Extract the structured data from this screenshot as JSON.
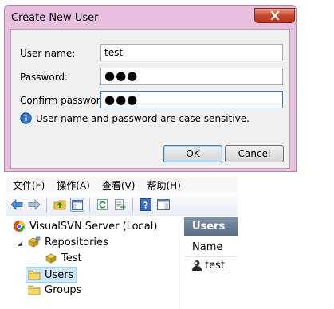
{
  "dialog": {
    "title": "Create New User",
    "username_label": "User name:",
    "username_value": "test",
    "password_label": "Password:",
    "password_value": "●●●",
    "confirm_label": "Confirm password:",
    "confirm_value": "●●●",
    "info_text": "User name and password are case sensitive.",
    "ok_label": "OK",
    "cancel_label": "Cancel"
  },
  "menubar": {
    "items": [
      "文件(F)",
      "操作(A)",
      "查看(V)",
      "帮助(H)"
    ]
  },
  "toolbar": {
    "icons": [
      "back-arrow-icon",
      "forward-arrow-icon",
      "up-folder-icon",
      "show-hide-tree-icon",
      "refresh-icon",
      "export-list-icon",
      "help-icon",
      "properties-pane-icon"
    ]
  },
  "tree": {
    "root": "VisualSVN Server (Local)",
    "repositories": "Repositories",
    "repo_test": "Test",
    "users": "Users",
    "groups": "Groups"
  },
  "right_pane": {
    "header": "Users",
    "column_name": "Name",
    "rows": [
      "test"
    ]
  },
  "colors": {
    "dialog_frame": "#e7c0df",
    "close_button": "#c9462c",
    "selection": "#cde8ff",
    "pane_header": "#6a7d97"
  }
}
